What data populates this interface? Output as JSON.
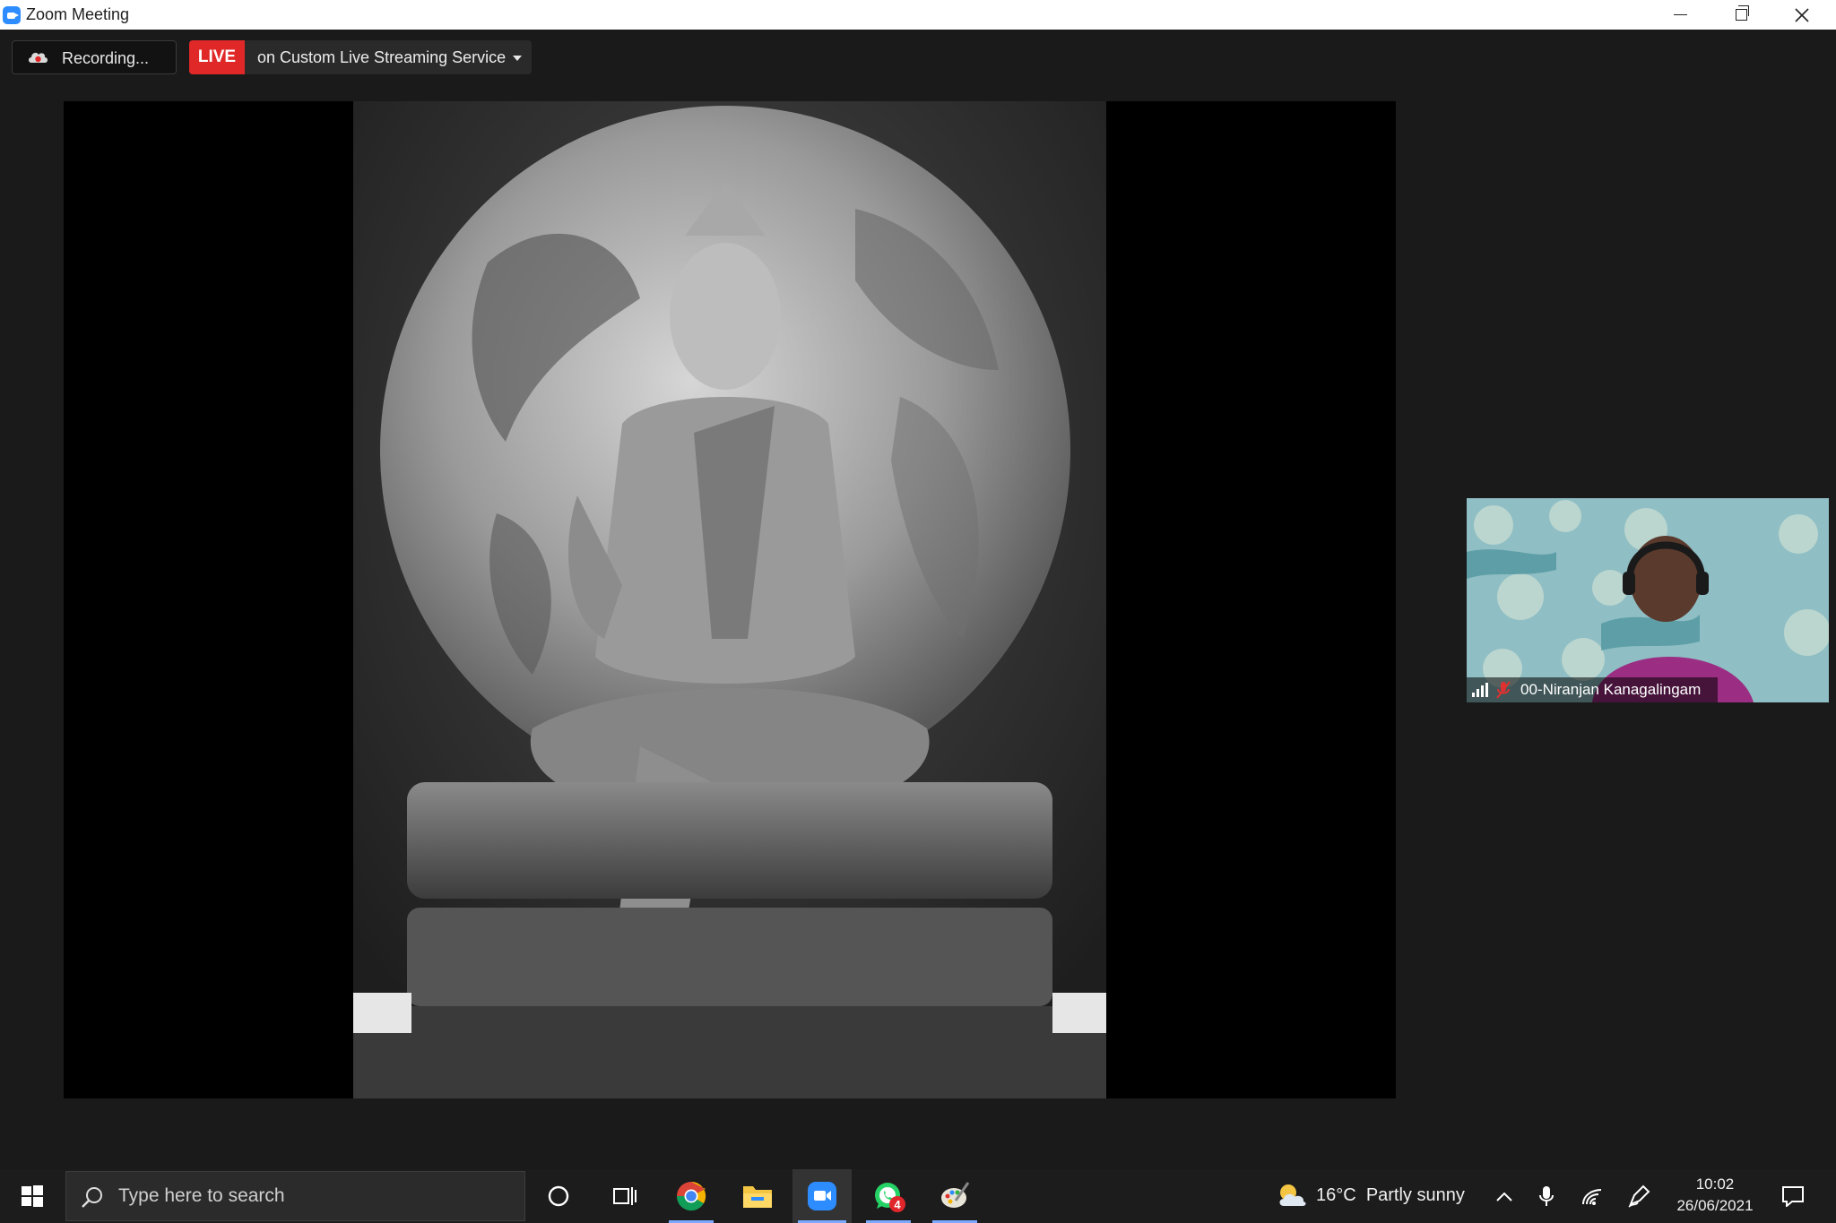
{
  "window": {
    "title": "Zoom Meeting",
    "controls": [
      "minimize",
      "restore",
      "close"
    ]
  },
  "meeting_bar": {
    "recording_label": "Recording...",
    "live_badge": "LIVE",
    "live_label": "on Custom Live Streaming Service"
  },
  "shared_screen": {
    "content": "shared-image"
  },
  "participant": {
    "name": "00-Niranjan Kanagalingam",
    "mic_muted": true
  },
  "taskbar": {
    "search_placeholder": "Type here to search",
    "apps": [
      {
        "name": "cortana-icon"
      },
      {
        "name": "task-view-icon"
      },
      {
        "name": "chrome-icon",
        "running": true
      },
      {
        "name": "file-explorer-icon"
      },
      {
        "name": "zoom-icon",
        "active": true
      },
      {
        "name": "whatsapp-icon",
        "running": true,
        "badge": "4"
      },
      {
        "name": "paint-icon",
        "running": true
      }
    ],
    "weather": {
      "temperature": "16°C",
      "condition": "Partly sunny"
    },
    "clock": {
      "time": "10:02",
      "date": "26/06/2021"
    }
  },
  "colors": {
    "zoom_blue": "#2d8cff",
    "live_red": "#e02828",
    "background": "#1a1a1a",
    "taskbar": "#1c1c1c"
  }
}
